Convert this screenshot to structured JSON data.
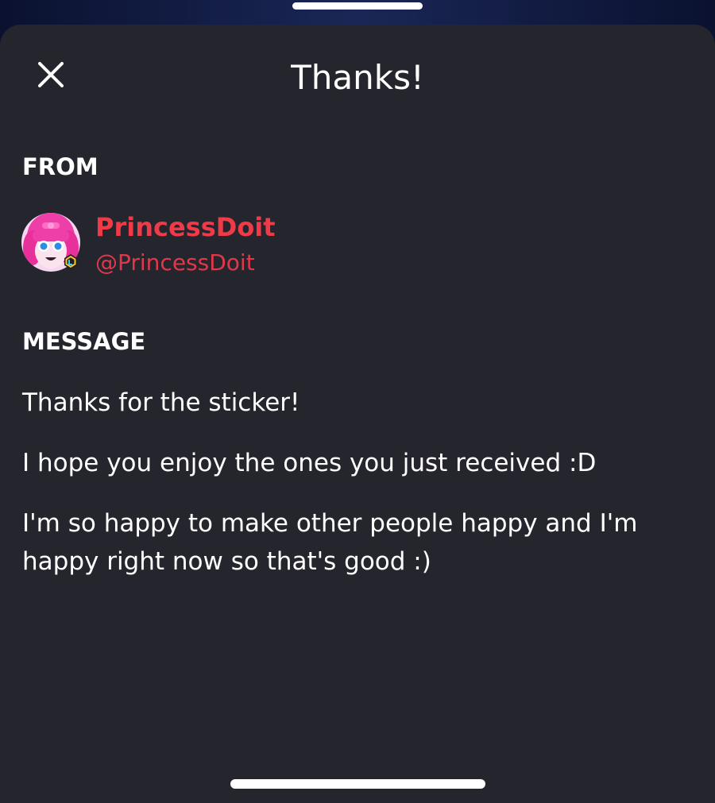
{
  "header": {
    "title": "Thanks!",
    "close_icon": "close-icon"
  },
  "from": {
    "label": "FROM",
    "display_name": "PrincessDoit",
    "handle": "@PrincessDoit",
    "name_color": "#f03a48"
  },
  "message": {
    "label": "MESSAGE",
    "paragraphs": [
      "Thanks for the sticker!",
      "I hope you enjoy the ones you just received :D",
      "I'm so happy to make other people happy and I'm happy right now so that's good :)"
    ]
  },
  "colors": {
    "sheet_background": "#25252e",
    "accent": "#f03a48",
    "text": "#ffffff"
  }
}
